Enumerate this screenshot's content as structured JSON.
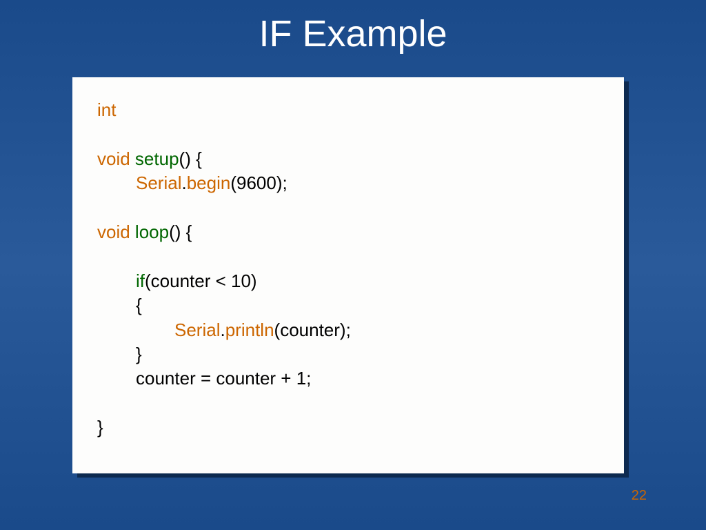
{
  "title": "IF Example",
  "code": {
    "l1_kw": "int",
    "l2_kw": "void",
    "l2_fn": " setup",
    "l2_rest": "() {",
    "l3_obj": "Serial",
    "l3_dot": ".",
    "l3_fn": "begin",
    "l3_args": "(9600);",
    "l4_kw": "void",
    "l4_fn": " loop",
    "l4_rest": "() {",
    "l5_if": "if",
    "l5_cond": "(counter < 10)",
    "l6_brace": "{",
    "l7_obj": "Serial",
    "l7_dot": ".",
    "l7_fn": "println",
    "l7_args": "(counter);",
    "l8_brace": "}",
    "l9_stmt": "counter = counter + 1;",
    "l10_brace": "}"
  },
  "page_number": "22"
}
